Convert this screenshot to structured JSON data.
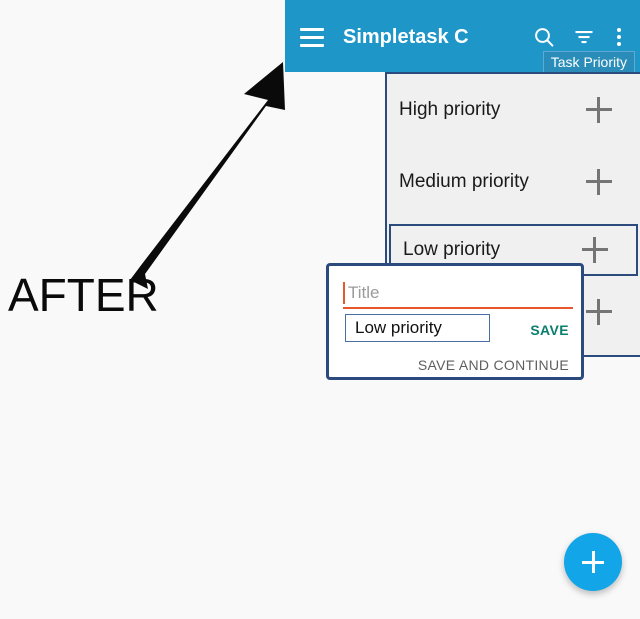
{
  "annotation": {
    "label": "AFTER",
    "arrow_icon": "arrow-up-right-icon"
  },
  "app_bar": {
    "menu_icon": "hamburger-menu-icon",
    "title": "Simpletask C",
    "search_icon": "search-icon",
    "filter_icon": "filter-icon",
    "overflow_icon": "more-vertical-icon",
    "tooltip": "Task Priority",
    "background_color": "#1e96c8"
  },
  "priority_panel": {
    "add_icon": "plus-icon",
    "rows": [
      {
        "label": "High priority",
        "selected": false
      },
      {
        "label": "Medium priority",
        "selected": false
      },
      {
        "label": "Low priority",
        "selected": true
      },
      {
        "label": "",
        "selected": false
      }
    ],
    "highlight_color": "#2b4a7d"
  },
  "dialog": {
    "title_placeholder": "Title",
    "title_value": "",
    "caret_color": "#e8562b",
    "chip_value": "Low priority",
    "save_label": "SAVE",
    "save_color": "#0a7f6e",
    "save_and_continue_label": "SAVE AND CONTINUE",
    "border_color": "#2b4a7d"
  },
  "fab": {
    "icon": "plus-icon",
    "color": "#12a5e8"
  }
}
